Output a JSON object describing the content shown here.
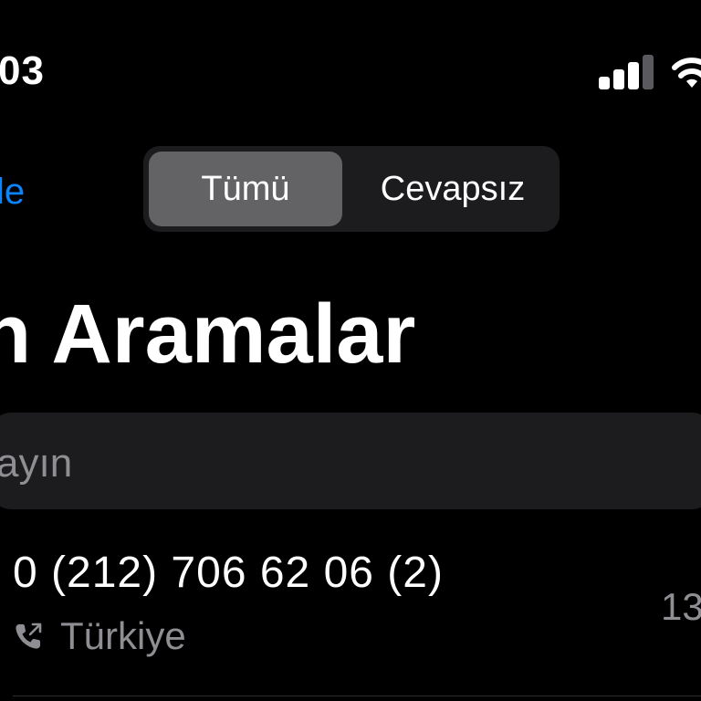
{
  "status_bar": {
    "time": "03",
    "signal_bars_active": 3,
    "signal_bars_total": 4,
    "wifi": "wifi-icon"
  },
  "nav": {
    "edit_label": "le",
    "segments": [
      {
        "label": "Tümü",
        "selected": true
      },
      {
        "label": "Cevapsız",
        "selected": false
      }
    ]
  },
  "title": "n Aramalar",
  "search": {
    "placeholder": "ayın"
  },
  "calls": [
    {
      "number": "0 (212) 706 62 06 (2)",
      "location": "Türkiye",
      "time": "13",
      "icon": "phone-outgoing-icon"
    }
  ],
  "colors": {
    "background": "#000000",
    "text_primary": "#ffffff",
    "text_secondary": "#8e8e93",
    "accent": "#0a84ff",
    "segment_bg": "#1c1c1e",
    "segment_selected_bg": "#636366",
    "search_bg": "#1c1c1e",
    "signal_inactive": "#5a5a5e"
  }
}
